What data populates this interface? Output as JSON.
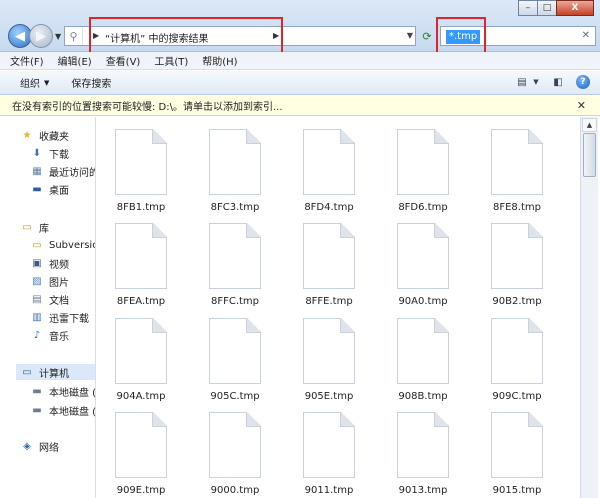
{
  "window": {
    "minimize": "–",
    "maximize": "□",
    "close": "X"
  },
  "address": {
    "breadcrumb": "“计算机” 中的搜索结果"
  },
  "search": {
    "query": "*.tmp"
  },
  "menu": [
    "文件(F)",
    "编辑(E)",
    "查看(V)",
    "工具(T)",
    "帮助(H)"
  ],
  "toolbar": {
    "organize": "组织",
    "save_search": "保存搜索"
  },
  "infobar": {
    "message": "在没有索引的位置搜索可能较慢: D:\\。请单击以添加到索引..."
  },
  "sidebar": {
    "favorites": {
      "label": "收藏夹",
      "items": [
        "下载",
        "最近访问的",
        "桌面"
      ]
    },
    "libraries": {
      "label": "库",
      "items": [
        "Subversion",
        "视频",
        "图片",
        "文档",
        "迅雷下载",
        "音乐"
      ]
    },
    "computer": {
      "label": "计算机",
      "items": [
        "本地磁盘 (C",
        "本地磁盘 (D"
      ]
    },
    "network": {
      "label": "网络"
    }
  },
  "files": [
    "8FB1.tmp",
    "8FC3.tmp",
    "8FD4.tmp",
    "8FD6.tmp",
    "8FE8.tmp",
    "8FEA.tmp",
    "8FFC.tmp",
    "8FFE.tmp",
    "90A0.tmp",
    "90B2.tmp",
    "904A.tmp",
    "905C.tmp",
    "905E.tmp",
    "908B.tmp",
    "909C.tmp",
    "909E.tmp",
    "9000.tmp",
    "9011.tmp",
    "9013.tmp",
    "9015.tmp"
  ],
  "icons": {
    "back": "arrow-left-icon",
    "forward": "arrow-right-icon",
    "refresh": "refresh-icon",
    "favorites": "star-icon",
    "library": "library-icon",
    "computer": "computer-icon",
    "network": "network-icon"
  }
}
